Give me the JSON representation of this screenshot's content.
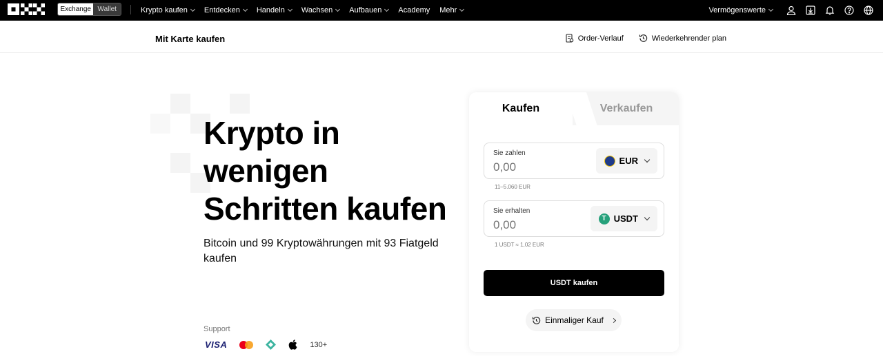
{
  "nav": {
    "switch_exchange": "Exchange",
    "switch_wallet": "Wallet",
    "menu": [
      "Krypto kaufen",
      "Entdecken",
      "Handeln",
      "Wachsen",
      "Aufbauen",
      "Academy",
      "Mehr"
    ],
    "assets_label": "Vermögenswerte",
    "icons": [
      "user-icon",
      "download-icon",
      "bell-icon",
      "help-icon",
      "globe-icon"
    ]
  },
  "subheader": {
    "title": "Mit Karte kaufen",
    "order_history": "Order-Verlauf",
    "recurring_plan": "Wiederkehrender plan"
  },
  "hero": {
    "line1": "Krypto in",
    "line2": "wenigen",
    "line3": "Schritten kaufen",
    "subtitle": "Bitcoin und 99 Kryptowährungen mit 93 Fiatgeld kaufen",
    "support_label": "Support",
    "payment_visa": "VISA",
    "payment_count": "130+"
  },
  "card": {
    "tab_buy": "Kaufen",
    "tab_sell": "Verkaufen",
    "pay": {
      "label": "Sie zahlen",
      "placeholder": "0,00",
      "currency": "EUR",
      "hint": "11–5.060 EUR"
    },
    "receive": {
      "label": "Sie erhalten",
      "placeholder": "0,00",
      "currency": "USDT",
      "hint": "1 USDT ≈ 1,02 EUR"
    },
    "buy_button": "USDT kaufen",
    "one_time_button": "Einmaliger Kauf"
  },
  "colors": {
    "accent": "#000000",
    "usdt": "#26a17b",
    "eur": "#1e3a8a"
  }
}
